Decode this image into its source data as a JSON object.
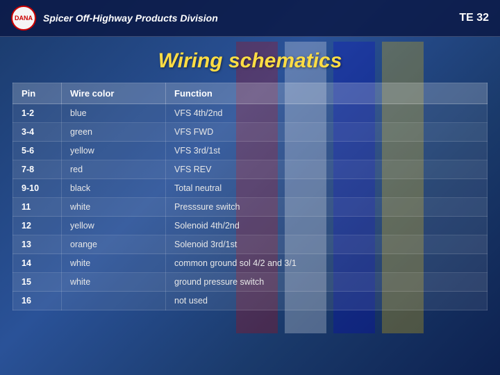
{
  "header": {
    "logo_text": "DANA",
    "company_name": "Spicer Off-Highway Products Division",
    "slide_number": "TE 32"
  },
  "title": "Wiring schematics",
  "table": {
    "columns": [
      "Pin",
      "Wire color",
      "Function"
    ],
    "rows": [
      {
        "pin": "1-2",
        "wire_color": "blue",
        "function": "VFS 4th/2nd"
      },
      {
        "pin": "3-4",
        "wire_color": "green",
        "function": "VFS FWD"
      },
      {
        "pin": "5-6",
        "wire_color": "yellow",
        "function": "VFS 3rd/1st"
      },
      {
        "pin": "7-8",
        "wire_color": "red",
        "function": "VFS REV"
      },
      {
        "pin": "9-10",
        "wire_color": "black",
        "function": "Total neutral"
      },
      {
        "pin": "11",
        "wire_color": "white",
        "function": "Presssure switch"
      },
      {
        "pin": "12",
        "wire_color": "yellow",
        "function": "Solenoid 4th/2nd"
      },
      {
        "pin": "13",
        "wire_color": "orange",
        "function": "Solenoid 3rd/1st"
      },
      {
        "pin": "14",
        "wire_color": "white",
        "function": "common ground sol 4/2 and 3/1"
      },
      {
        "pin": "15",
        "wire_color": "white",
        "function": "ground pressure switch"
      },
      {
        "pin": "16",
        "wire_color": "",
        "function": "not used"
      }
    ]
  }
}
